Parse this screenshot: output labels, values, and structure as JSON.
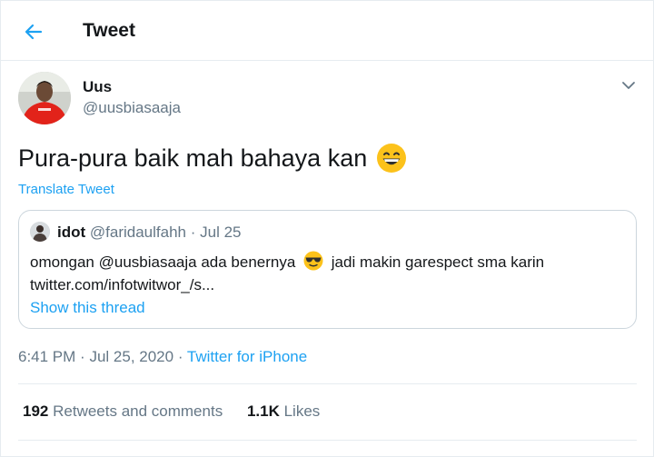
{
  "header": {
    "title": "Tweet"
  },
  "tweet": {
    "display_name": "Uus",
    "handle": "@uusbiasaaja",
    "text": "Pura-pura baik mah bahaya kan",
    "translate_label": "Translate Tweet",
    "time": "6:41 PM",
    "date": "Jul 25, 2020",
    "source": "Twitter for iPhone",
    "separator": "·"
  },
  "quote": {
    "display_name": "idot",
    "handle": "@faridaulfahh",
    "date": "Jul 25",
    "separator": "·",
    "text_part1": "omongan  @uusbiasaaja  ada benernya",
    "text_part2": "jadi makin garespect sma karin",
    "link": "twitter.com/infotwitwor_/s...",
    "show_thread": "Show this thread"
  },
  "stats": {
    "retweets_count": "192",
    "retweets_label": "Retweets and comments",
    "likes_count": "1.1K",
    "likes_label": "Likes"
  },
  "colors": {
    "accent": "#1da1f2",
    "secondary_text": "#657786",
    "border": "#e6ecf0"
  },
  "icons": [
    "back-arrow-icon",
    "chevron-down-icon",
    "grinning-emoji",
    "sunglasses-emoji"
  ]
}
